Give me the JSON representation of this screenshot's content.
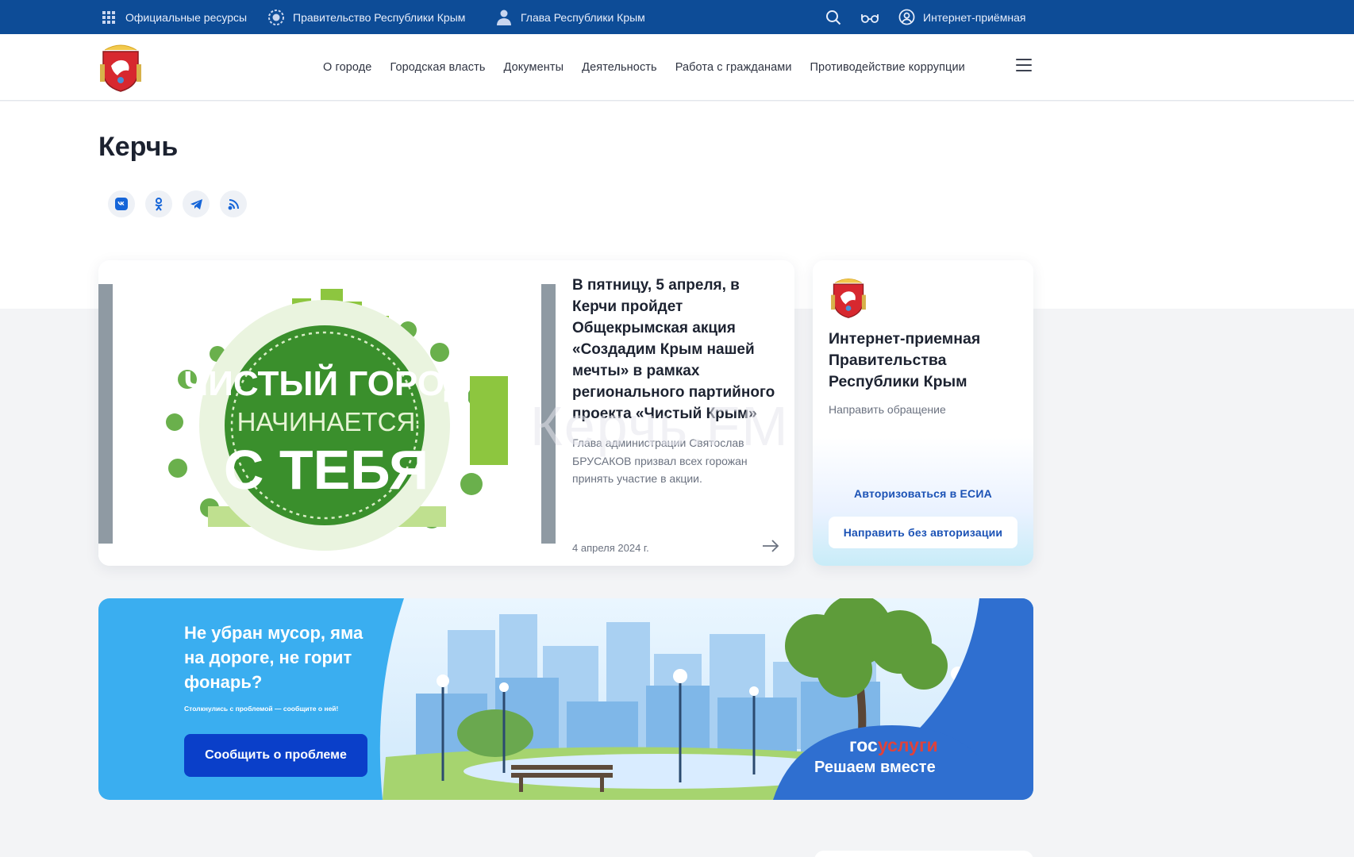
{
  "topbar": {
    "official": "Официальные ресурсы",
    "government": "Правительство Республики Крым",
    "head": "Глава Республики Крым",
    "reception": "Интернет-приёмная"
  },
  "nav": {
    "items": [
      "О городе",
      "Городская власть",
      "Документы",
      "Деятельность",
      "Работа с гражданами",
      "Противодействие коррупции"
    ]
  },
  "page": {
    "title": "Керчь"
  },
  "social": [
    "vk-icon",
    "ok-icon",
    "telegram-icon",
    "rss-icon"
  ],
  "news": {
    "title": "В пятницу, 5 апреля, в Керчи пройдет Общекрымская акция «Создадим Крым нашей мечты» в рамках регионального партийного проекта «Чистый Крым»",
    "lead": "Глава администрации Святослав БРУСАКОВ призвал всех горожан принять участие в акции.",
    "date": "4 апреля 2024 г.",
    "image_text": {
      "line1": "ЧИСТЫЙ ГОРОД",
      "line2": "НАЧИНАЕТСЯ",
      "line3": "С ТЕБЯ"
    }
  },
  "reception": {
    "title": "Интернет-приемная Правительства Республики Крым",
    "subtitle": "Направить обращение",
    "esia_button": "Авторизоваться в ЕСИА",
    "noauth_button": "Направить без авторизации"
  },
  "banner": {
    "title": "Не убран мусор, яма на дороге, не горит фонарь?",
    "small": "Столкнулись с проблемой — сообщите о ней!",
    "button": "Сообщить о проблеме",
    "logo_part1": "гос",
    "logo_part2": "услуги",
    "slogan": "Решаем вместе"
  },
  "watermark": "Керчь.FM",
  "colors": {
    "topbar": "#0d4c97",
    "accent": "#1b52b5",
    "banner": "#3aaef0",
    "banner_button": "#0a3fc9",
    "green": "#3a8f2c"
  }
}
